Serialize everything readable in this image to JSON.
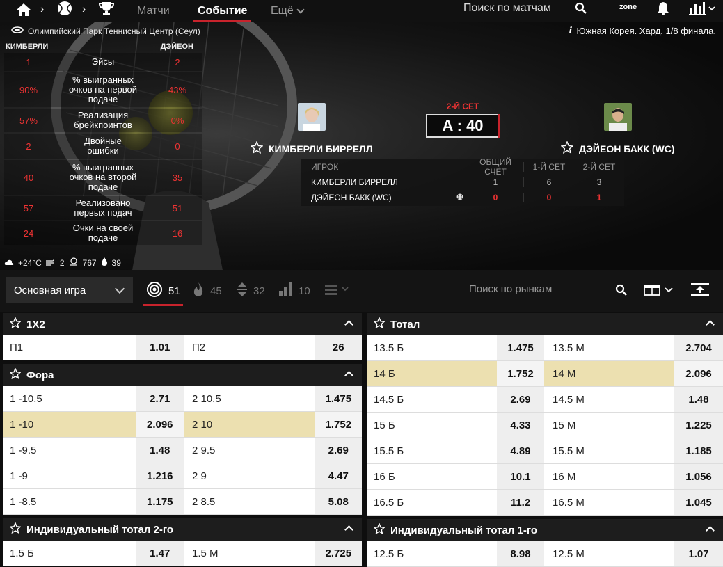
{
  "nav": {
    "tabs": [
      {
        "label": "Матчи"
      },
      {
        "label": "Событие"
      },
      {
        "label": "Ещё"
      }
    ],
    "search_placeholder": "Поиск по матчам",
    "zone_label": "zone"
  },
  "event": {
    "venue": "Олимпийский Парк Теннисный Центр (Сеул)",
    "info": "Южная Корея. Хард. 1/8 финала.",
    "set_label": "2-Й СЕТ",
    "game_score": "A : 40",
    "player1": "КИМБЕРЛИ БИРРЕЛЛ",
    "player2": "ДЭЙЕОН БАКК (WC)",
    "stats_header": {
      "p1": "КИМБЕРЛИ",
      "p2": "ДЭЙЕОН"
    },
    "stats": [
      {
        "label": "Эйсы",
        "v1": "1",
        "v2": "2"
      },
      {
        "label": "% выигранных очков на первой подаче",
        "v1": "90%",
        "v2": "43%"
      },
      {
        "label": "Реализация брейкпоинтов",
        "v1": "57%",
        "v2": "0%"
      },
      {
        "label": "Двойные ошибки",
        "v1": "2",
        "v2": "0"
      },
      {
        "label": "% выигранных очков на второй подаче",
        "v1": "40",
        "v2": "35"
      },
      {
        "label": "Реализовано первых подач",
        "v1": "57",
        "v2": "51"
      },
      {
        "label": "Очки на своей подаче",
        "v1": "24",
        "v2": "16"
      }
    ],
    "weather": {
      "temp": "+24°C",
      "wind": "2",
      "pressure": "767",
      "humidity": "39"
    },
    "scoretable": {
      "headers": {
        "player": "ИГРОК",
        "total": "ОБЩИЙ СЧЁТ",
        "s1": "1-Й СЕТ",
        "s2": "2-Й СЕТ"
      },
      "rows": [
        {
          "name": "КИМБЕРЛИ БИРРЕЛЛ",
          "total": "1",
          "s1": "6",
          "s2": "3"
        },
        {
          "name": "ДЭЙЕОН БАКК (WC)",
          "total": "0",
          "s1": "0",
          "s2": "1"
        }
      ]
    }
  },
  "filters": {
    "dropdown": "Основная игра",
    "tabs": [
      {
        "icon": "target-icon",
        "count": "51"
      },
      {
        "icon": "flame-icon",
        "count": "45"
      },
      {
        "icon": "up-down-icon",
        "count": "32"
      },
      {
        "icon": "chart-list-icon",
        "count": "10"
      }
    ],
    "market_search_placeholder": "Поиск по рынкам"
  },
  "markets": {
    "x12": {
      "title": "1X2",
      "rows": [
        {
          "n1": "П1",
          "o1": "1.01",
          "n2": "П2",
          "o2": "26"
        }
      ]
    },
    "fora": {
      "title": "Фора",
      "rows": [
        {
          "n1": "1 -10.5",
          "o1": "2.71",
          "n2": "2 10.5",
          "o2": "1.475"
        },
        {
          "n1": "1 -10",
          "o1": "2.096",
          "n2": "2 10",
          "o2": "1.752"
        },
        {
          "n1": "1 -9.5",
          "o1": "1.48",
          "n2": "2 9.5",
          "o2": "2.69"
        },
        {
          "n1": "1 -9",
          "o1": "1.216",
          "n2": "2 9",
          "o2": "4.47"
        },
        {
          "n1": "1 -8.5",
          "o1": "1.175",
          "n2": "2 8.5",
          "o2": "5.08"
        }
      ]
    },
    "ind2": {
      "title": "Индивидуальный тотал 2-го",
      "rows": [
        {
          "n1": "1.5 Б",
          "o1": "1.47",
          "n2": "1.5 М",
          "o2": "2.725"
        }
      ]
    },
    "total": {
      "title": "Тотал",
      "rows": [
        {
          "n1": "13.5 Б",
          "o1": "1.475",
          "n2": "13.5 М",
          "o2": "2.704"
        },
        {
          "n1": "14 Б",
          "o1": "1.752",
          "n2": "14 М",
          "o2": "2.096"
        },
        {
          "n1": "14.5 Б",
          "o1": "2.69",
          "n2": "14.5 М",
          "o2": "1.48"
        },
        {
          "n1": "15 Б",
          "o1": "4.33",
          "n2": "15 М",
          "o2": "1.225"
        },
        {
          "n1": "15.5 Б",
          "o1": "4.89",
          "n2": "15.5 М",
          "o2": "1.185"
        },
        {
          "n1": "16 Б",
          "o1": "10.1",
          "n2": "16 М",
          "o2": "1.056"
        },
        {
          "n1": "16.5 Б",
          "o1": "11.2",
          "n2": "16.5 М",
          "o2": "1.045"
        }
      ]
    },
    "ind1": {
      "title": "Индивидуальный тотал 1-го",
      "rows": [
        {
          "n1": "12.5 Б",
          "o1": "8.98",
          "n2": "12.5 М",
          "o2": "1.07"
        }
      ]
    }
  },
  "colors": {
    "accent": "#c8232c",
    "highlight": "#ece0b0",
    "stat_value": "#e33333"
  }
}
